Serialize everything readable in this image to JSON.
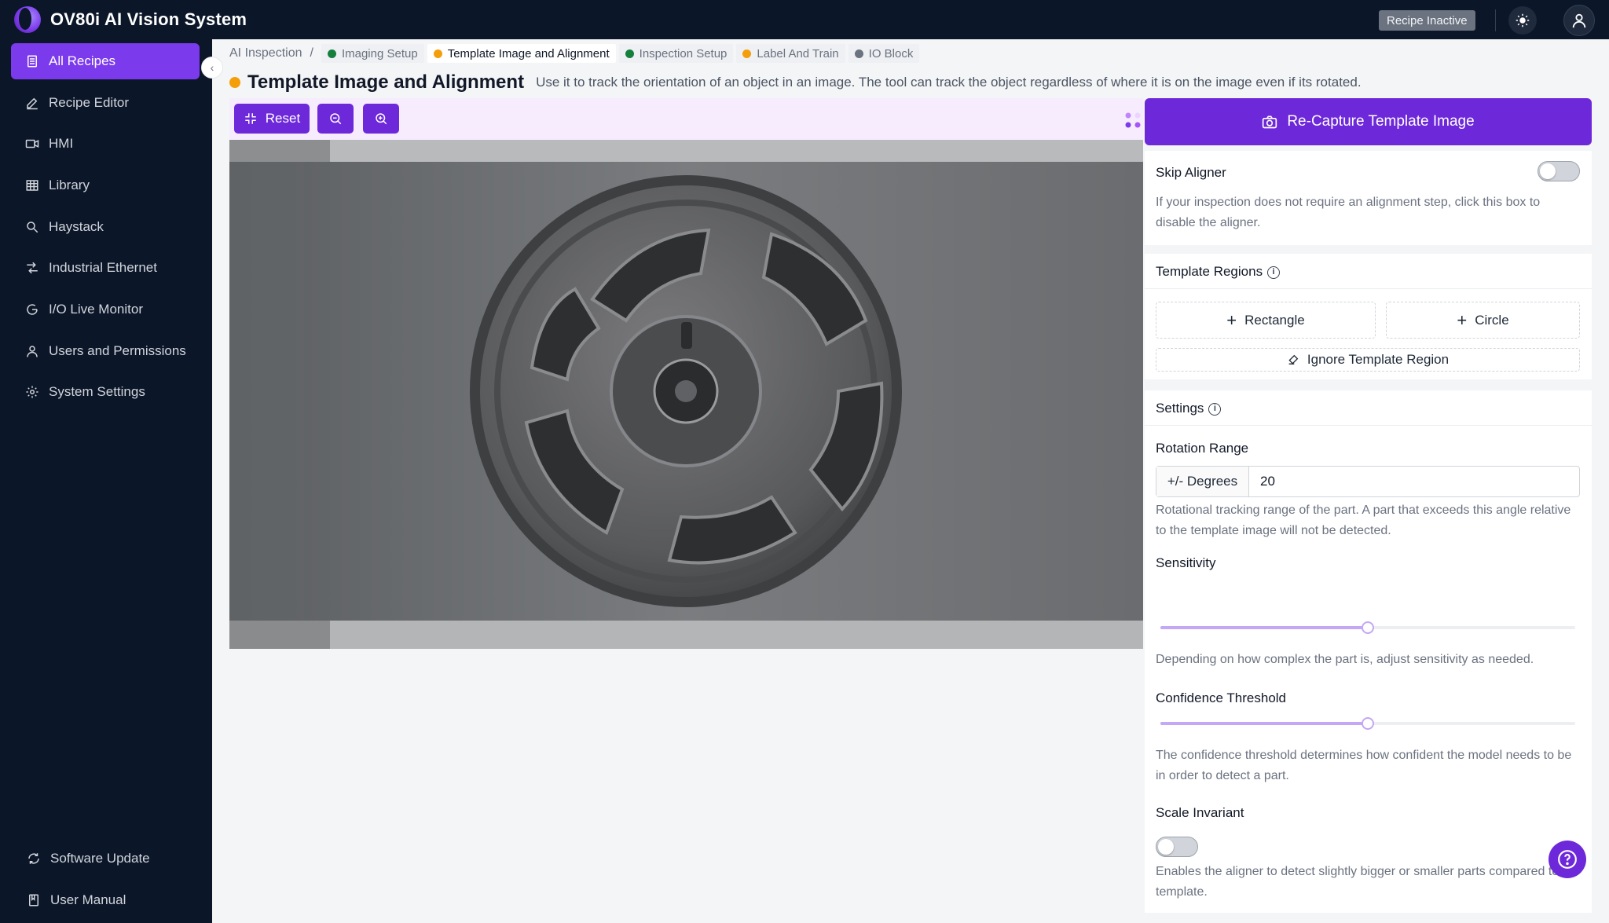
{
  "app": {
    "title": "OV80i AI Vision System",
    "recipe_status": "Recipe Inactive"
  },
  "sidebar": {
    "items": [
      {
        "label": "All Recipes",
        "icon": "recipes-icon",
        "active": true
      },
      {
        "label": "Recipe Editor",
        "icon": "pencil-icon"
      },
      {
        "label": "HMI",
        "icon": "video-icon"
      },
      {
        "label": "Library",
        "icon": "grid-icon"
      },
      {
        "label": "Haystack",
        "icon": "search-icon"
      },
      {
        "label": "Industrial Ethernet",
        "icon": "network-icon"
      },
      {
        "label": "I/O Live Monitor",
        "icon": "monitor-icon"
      },
      {
        "label": "Users and Permissions",
        "icon": "user-icon"
      },
      {
        "label": "System Settings",
        "icon": "gear-icon"
      }
    ],
    "bottom": [
      {
        "label": "Software Update",
        "icon": "refresh-icon"
      },
      {
        "label": "User Manual",
        "icon": "book-icon"
      }
    ]
  },
  "breadcrumb": {
    "root": "AI Inspection",
    "separator": "/",
    "steps": [
      {
        "label": "Imaging Setup",
        "status_color": "#15803d"
      },
      {
        "label": "Template Image and Alignment",
        "status_color": "#f59e0b",
        "active": true
      },
      {
        "label": "Inspection Setup",
        "status_color": "#15803d"
      },
      {
        "label": "Label And Train",
        "status_color": "#f59e0b"
      },
      {
        "label": "IO Block",
        "status_color": "#6b7280"
      }
    ]
  },
  "page": {
    "title": "Template Image and Alignment",
    "description": "Use it to track the orientation of an object in an image. The tool can track the object regardless of where it is on the image even if its rotated."
  },
  "toolbar": {
    "reset_label": "Reset"
  },
  "right_panel": {
    "recapture_label": "Re-Capture Template Image",
    "skip_aligner": {
      "title": "Skip Aligner",
      "enabled": false,
      "help": "If your inspection does not require an alignment step, click this box to disable the aligner."
    },
    "template_regions": {
      "title": "Template Regions",
      "rectangle_label": "Rectangle",
      "circle_label": "Circle",
      "ignore_label": "Ignore Template Region"
    },
    "settings": {
      "title": "Settings",
      "rotation_range": {
        "label": "Rotation Range",
        "addon": "+/- Degrees",
        "value": "20",
        "help": "Rotational tracking range of the part. A part that exceeds this angle relative to the template image will not be detected."
      },
      "sensitivity": {
        "label": "Sensitivity",
        "value_fraction": 0.5,
        "help": "Depending on how complex the part is, adjust sensitivity as needed."
      },
      "confidence_threshold": {
        "label": "Confidence Threshold",
        "value_fraction": 0.5,
        "help": "The confidence threshold determines how confident the model needs to be in order to detect a part."
      },
      "scale_invariant": {
        "label": "Scale Invariant",
        "enabled": false,
        "help": "Enables the aligner to detect slightly bigger or smaller parts compared to the template."
      }
    }
  },
  "colors": {
    "accent": "#6d28d9",
    "sidebar_bg": "#0b1629",
    "toolbar_bg": "#f6ecfd"
  }
}
